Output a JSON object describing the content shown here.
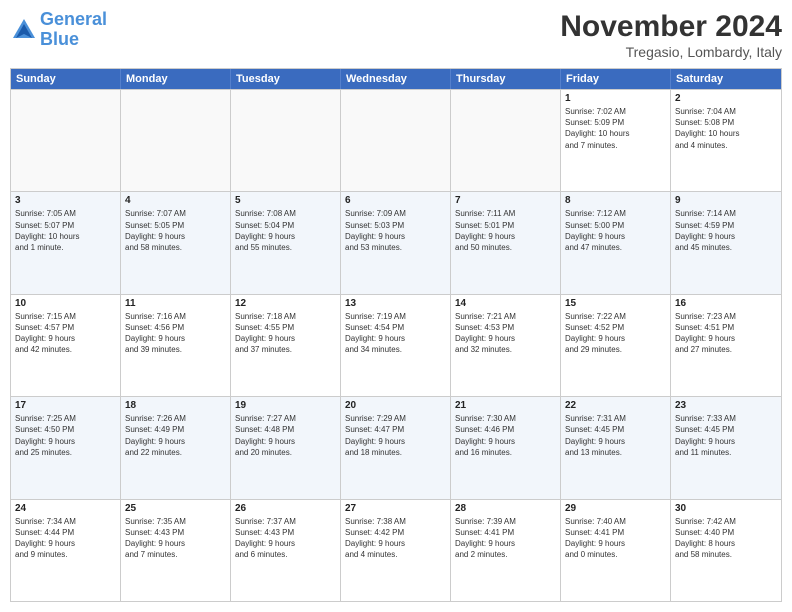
{
  "header": {
    "logo_line1": "General",
    "logo_line2": "Blue",
    "month_title": "November 2024",
    "location": "Tregasio, Lombardy, Italy"
  },
  "weekdays": [
    "Sunday",
    "Monday",
    "Tuesday",
    "Wednesday",
    "Thursday",
    "Friday",
    "Saturday"
  ],
  "rows": [
    {
      "alt": false,
      "cells": [
        {
          "day": "",
          "info": ""
        },
        {
          "day": "",
          "info": ""
        },
        {
          "day": "",
          "info": ""
        },
        {
          "day": "",
          "info": ""
        },
        {
          "day": "",
          "info": ""
        },
        {
          "day": "1",
          "info": "Sunrise: 7:02 AM\nSunset: 5:09 PM\nDaylight: 10 hours\nand 7 minutes."
        },
        {
          "day": "2",
          "info": "Sunrise: 7:04 AM\nSunset: 5:08 PM\nDaylight: 10 hours\nand 4 minutes."
        }
      ]
    },
    {
      "alt": true,
      "cells": [
        {
          "day": "3",
          "info": "Sunrise: 7:05 AM\nSunset: 5:07 PM\nDaylight: 10 hours\nand 1 minute."
        },
        {
          "day": "4",
          "info": "Sunrise: 7:07 AM\nSunset: 5:05 PM\nDaylight: 9 hours\nand 58 minutes."
        },
        {
          "day": "5",
          "info": "Sunrise: 7:08 AM\nSunset: 5:04 PM\nDaylight: 9 hours\nand 55 minutes."
        },
        {
          "day": "6",
          "info": "Sunrise: 7:09 AM\nSunset: 5:03 PM\nDaylight: 9 hours\nand 53 minutes."
        },
        {
          "day": "7",
          "info": "Sunrise: 7:11 AM\nSunset: 5:01 PM\nDaylight: 9 hours\nand 50 minutes."
        },
        {
          "day": "8",
          "info": "Sunrise: 7:12 AM\nSunset: 5:00 PM\nDaylight: 9 hours\nand 47 minutes."
        },
        {
          "day": "9",
          "info": "Sunrise: 7:14 AM\nSunset: 4:59 PM\nDaylight: 9 hours\nand 45 minutes."
        }
      ]
    },
    {
      "alt": false,
      "cells": [
        {
          "day": "10",
          "info": "Sunrise: 7:15 AM\nSunset: 4:57 PM\nDaylight: 9 hours\nand 42 minutes."
        },
        {
          "day": "11",
          "info": "Sunrise: 7:16 AM\nSunset: 4:56 PM\nDaylight: 9 hours\nand 39 minutes."
        },
        {
          "day": "12",
          "info": "Sunrise: 7:18 AM\nSunset: 4:55 PM\nDaylight: 9 hours\nand 37 minutes."
        },
        {
          "day": "13",
          "info": "Sunrise: 7:19 AM\nSunset: 4:54 PM\nDaylight: 9 hours\nand 34 minutes."
        },
        {
          "day": "14",
          "info": "Sunrise: 7:21 AM\nSunset: 4:53 PM\nDaylight: 9 hours\nand 32 minutes."
        },
        {
          "day": "15",
          "info": "Sunrise: 7:22 AM\nSunset: 4:52 PM\nDaylight: 9 hours\nand 29 minutes."
        },
        {
          "day": "16",
          "info": "Sunrise: 7:23 AM\nSunset: 4:51 PM\nDaylight: 9 hours\nand 27 minutes."
        }
      ]
    },
    {
      "alt": true,
      "cells": [
        {
          "day": "17",
          "info": "Sunrise: 7:25 AM\nSunset: 4:50 PM\nDaylight: 9 hours\nand 25 minutes."
        },
        {
          "day": "18",
          "info": "Sunrise: 7:26 AM\nSunset: 4:49 PM\nDaylight: 9 hours\nand 22 minutes."
        },
        {
          "day": "19",
          "info": "Sunrise: 7:27 AM\nSunset: 4:48 PM\nDaylight: 9 hours\nand 20 minutes."
        },
        {
          "day": "20",
          "info": "Sunrise: 7:29 AM\nSunset: 4:47 PM\nDaylight: 9 hours\nand 18 minutes."
        },
        {
          "day": "21",
          "info": "Sunrise: 7:30 AM\nSunset: 4:46 PM\nDaylight: 9 hours\nand 16 minutes."
        },
        {
          "day": "22",
          "info": "Sunrise: 7:31 AM\nSunset: 4:45 PM\nDaylight: 9 hours\nand 13 minutes."
        },
        {
          "day": "23",
          "info": "Sunrise: 7:33 AM\nSunset: 4:45 PM\nDaylight: 9 hours\nand 11 minutes."
        }
      ]
    },
    {
      "alt": false,
      "cells": [
        {
          "day": "24",
          "info": "Sunrise: 7:34 AM\nSunset: 4:44 PM\nDaylight: 9 hours\nand 9 minutes."
        },
        {
          "day": "25",
          "info": "Sunrise: 7:35 AM\nSunset: 4:43 PM\nDaylight: 9 hours\nand 7 minutes."
        },
        {
          "day": "26",
          "info": "Sunrise: 7:37 AM\nSunset: 4:43 PM\nDaylight: 9 hours\nand 6 minutes."
        },
        {
          "day": "27",
          "info": "Sunrise: 7:38 AM\nSunset: 4:42 PM\nDaylight: 9 hours\nand 4 minutes."
        },
        {
          "day": "28",
          "info": "Sunrise: 7:39 AM\nSunset: 4:41 PM\nDaylight: 9 hours\nand 2 minutes."
        },
        {
          "day": "29",
          "info": "Sunrise: 7:40 AM\nSunset: 4:41 PM\nDaylight: 9 hours\nand 0 minutes."
        },
        {
          "day": "30",
          "info": "Sunrise: 7:42 AM\nSunset: 4:40 PM\nDaylight: 8 hours\nand 58 minutes."
        }
      ]
    }
  ]
}
